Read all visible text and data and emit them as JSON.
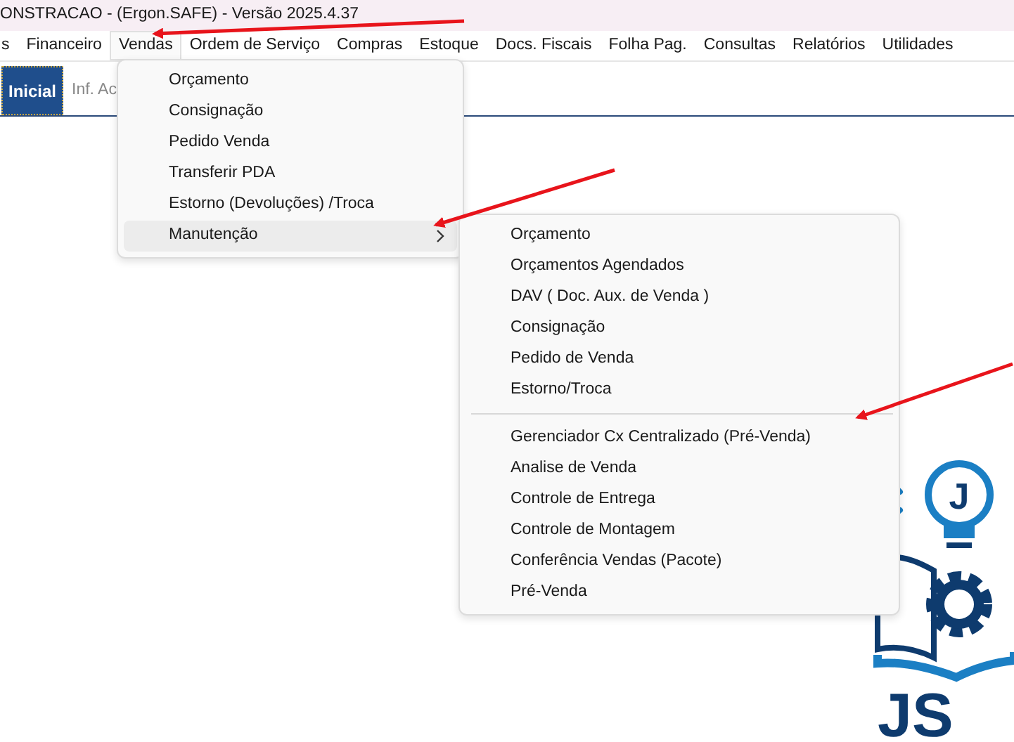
{
  "window": {
    "title": "ONSTRACAO - (Ergon.SAFE) - Versão 2025.4.37"
  },
  "menubar": [
    {
      "label": "s",
      "selected": false
    },
    {
      "label": "Financeiro",
      "selected": false
    },
    {
      "label": "Vendas",
      "selected": true
    },
    {
      "label": "Ordem de Serviço",
      "selected": false
    },
    {
      "label": "Compras",
      "selected": false
    },
    {
      "label": "Estoque",
      "selected": false
    },
    {
      "label": "Docs. Fiscais",
      "selected": false
    },
    {
      "label": "Folha Pag.",
      "selected": false
    },
    {
      "label": "Consultas",
      "selected": false
    },
    {
      "label": "Relatórios",
      "selected": false
    },
    {
      "label": "Utilidades",
      "selected": false
    }
  ],
  "tabs": [
    {
      "label": "Inicial",
      "selected": true
    },
    {
      "label": "Inf. Ac",
      "selected": false
    }
  ],
  "dropdown": {
    "items": [
      {
        "kind": "item",
        "label": "Orçamento",
        "selected": false
      },
      {
        "kind": "item",
        "label": "Consignação",
        "selected": false
      },
      {
        "kind": "item",
        "label": "Pedido Venda",
        "selected": false
      },
      {
        "kind": "item",
        "label": "Transferir PDA",
        "selected": false
      },
      {
        "kind": "item",
        "label": "Estorno (Devoluções) /Troca",
        "selected": false
      },
      {
        "kind": "submenu",
        "label": "Manutenção",
        "selected": true
      }
    ]
  },
  "submenu": {
    "items": [
      {
        "kind": "item",
        "label": "Orçamento"
      },
      {
        "kind": "item",
        "label": "Orçamentos Agendados"
      },
      {
        "kind": "item",
        "label": "DAV ( Doc. Aux. de Venda )"
      },
      {
        "kind": "item",
        "label": "Consignação"
      },
      {
        "kind": "item",
        "label": "Pedido de Venda"
      },
      {
        "kind": "item",
        "label": "Estorno/Troca"
      },
      {
        "kind": "separator"
      },
      {
        "kind": "item",
        "label": "Gerenciador Cx Centralizado (Pré-Venda)"
      },
      {
        "kind": "item",
        "label": "Analise de Venda"
      },
      {
        "kind": "item",
        "label": "Controle de Entrega"
      },
      {
        "kind": "item",
        "label": "Controle de Montagem"
      },
      {
        "kind": "item",
        "label": "Conferência Vendas (Pacote)"
      },
      {
        "kind": "item",
        "label": "Pré-Venda"
      }
    ]
  },
  "logo": {
    "badge_letter": "J",
    "wordmark": "JS"
  }
}
